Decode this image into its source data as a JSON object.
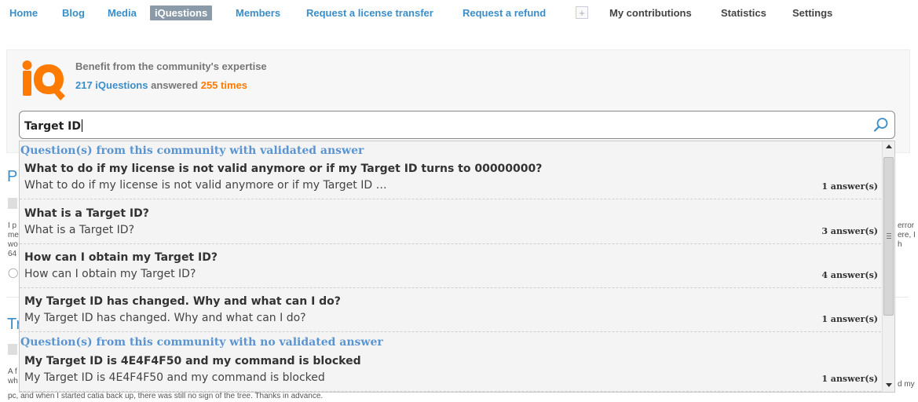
{
  "nav": {
    "items": [
      {
        "label": "Home"
      },
      {
        "label": "Blog"
      },
      {
        "label": "Media"
      },
      {
        "label": "iQuestions"
      },
      {
        "label": "Members"
      },
      {
        "label": "Request a license transfer"
      },
      {
        "label": "Request a refund"
      },
      {
        "label": "My contributions"
      },
      {
        "label": "Statistics"
      },
      {
        "label": "Settings"
      }
    ],
    "plus_label": "+",
    "active": "iQuestions"
  },
  "community": {
    "logo_text": "iQ",
    "benefit": "Benefit from the community's expertise",
    "questions_count": "217 iQuestions",
    "answered_label": "answered",
    "answers_count": "255 times"
  },
  "search": {
    "value": "Target ID",
    "icon": "search-icon"
  },
  "dropdown": {
    "validated_header": "Question(s) from this community with validated answer",
    "no_validated_header": "Question(s) from this community with no validated answer",
    "validated": [
      {
        "title": "What to do if my license is not valid anymore or if my Target ID turns to 00000000?",
        "excerpt": "What to do if my license is not valid anymore or if my Target ID …",
        "count": "1 answer(s)"
      },
      {
        "title": "What is a Target ID?",
        "excerpt": "What is a Target ID?",
        "count": "3 answer(s)"
      },
      {
        "title": "How can I obtain my Target ID?",
        "excerpt": "How can I obtain my Target ID?",
        "count": "4 answer(s)"
      },
      {
        "title": "My Target ID has changed. Why and what can I do?",
        "excerpt": "My Target ID has changed. Why and what can I do?",
        "count": "1 answer(s)"
      }
    ],
    "not_validated": [
      {
        "title": "My Target ID is 4E4F4F50 and my command is blocked",
        "excerpt": "My Target ID is 4E4F4F50 and my command is blocked",
        "count": "1 answer(s)"
      }
    ]
  },
  "background": {
    "title1_initial": "P",
    "title2_initial": "Tr",
    "line_a": "I p",
    "line_b": "me",
    "line_c": "wo",
    "line_d": "64",
    "line_e": "A f",
    "line_f": "wh",
    "right_a": "error",
    "right_b": "ere, I",
    "right_c": "h",
    "right_d": "d my",
    "bottom_line": "pc, and when I started catia back up, there was still no sign of the tree. Thanks in advance."
  },
  "colors": {
    "accent_blue": "#3a8ec9",
    "orange": "#ff7b00",
    "nav_active_bg": "#8a9aa8",
    "section_header": "#5b95d0"
  }
}
